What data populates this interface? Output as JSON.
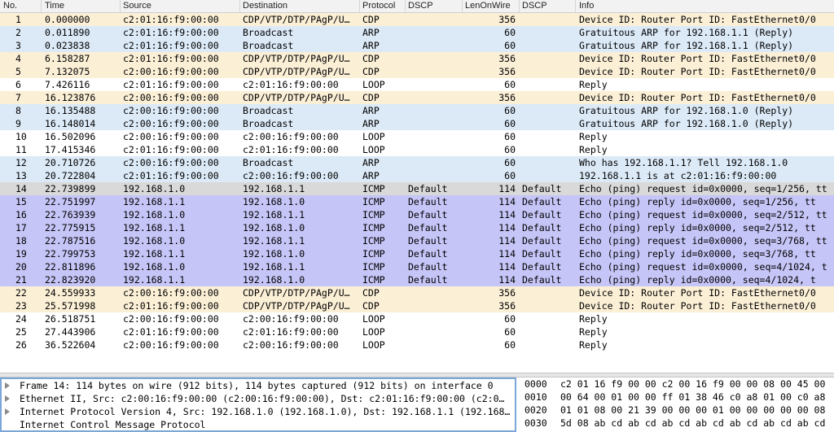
{
  "columns": [
    "No.",
    "Time",
    "Source",
    "Destination",
    "Protocol",
    "DSCP",
    "LenOnWire",
    "DSCP",
    "Info"
  ],
  "colors": {
    "cdp": "#fbefd6",
    "arp": "#dceaf8",
    "loop": "#ffffff",
    "icmp": "#c6c5f7",
    "selected": "#d9d9d9"
  },
  "packets": [
    {
      "no": "1",
      "time": "0.000000",
      "src": "c2:01:16:f9:00:00",
      "dst": "CDP/VTP/DTP/PAgP/U…",
      "proto": "CDP",
      "dscp": "",
      "len": "356",
      "dscp2": "",
      "info": "Device ID: Router  Port ID: FastEthernet0/0",
      "color": "cdp"
    },
    {
      "no": "2",
      "time": "0.011890",
      "src": "c2:01:16:f9:00:00",
      "dst": "Broadcast",
      "proto": "ARP",
      "dscp": "",
      "len": "60",
      "dscp2": "",
      "info": "Gratuitous ARP for 192.168.1.1 (Reply)",
      "color": "arp"
    },
    {
      "no": "3",
      "time": "0.023838",
      "src": "c2:01:16:f9:00:00",
      "dst": "Broadcast",
      "proto": "ARP",
      "dscp": "",
      "len": "60",
      "dscp2": "",
      "info": "Gratuitous ARP for 192.168.1.1 (Reply)",
      "color": "arp"
    },
    {
      "no": "4",
      "time": "6.158287",
      "src": "c2:01:16:f9:00:00",
      "dst": "CDP/VTP/DTP/PAgP/U…",
      "proto": "CDP",
      "dscp": "",
      "len": "356",
      "dscp2": "",
      "info": "Device ID: Router  Port ID: FastEthernet0/0",
      "color": "cdp"
    },
    {
      "no": "5",
      "time": "7.132075",
      "src": "c2:00:16:f9:00:00",
      "dst": "CDP/VTP/DTP/PAgP/U…",
      "proto": "CDP",
      "dscp": "",
      "len": "356",
      "dscp2": "",
      "info": "Device ID: Router  Port ID: FastEthernet0/0",
      "color": "cdp"
    },
    {
      "no": "6",
      "time": "7.426116",
      "src": "c2:01:16:f9:00:00",
      "dst": "c2:01:16:f9:00:00",
      "proto": "LOOP",
      "dscp": "",
      "len": "60",
      "dscp2": "",
      "info": "Reply",
      "color": "loop"
    },
    {
      "no": "7",
      "time": "16.123876",
      "src": "c2:00:16:f9:00:00",
      "dst": "CDP/VTP/DTP/PAgP/U…",
      "proto": "CDP",
      "dscp": "",
      "len": "356",
      "dscp2": "",
      "info": "Device ID: Router  Port ID: FastEthernet0/0",
      "color": "cdp"
    },
    {
      "no": "8",
      "time": "16.135488",
      "src": "c2:00:16:f9:00:00",
      "dst": "Broadcast",
      "proto": "ARP",
      "dscp": "",
      "len": "60",
      "dscp2": "",
      "info": "Gratuitous ARP for 192.168.1.0 (Reply)",
      "color": "arp"
    },
    {
      "no": "9",
      "time": "16.148014",
      "src": "c2:00:16:f9:00:00",
      "dst": "Broadcast",
      "proto": "ARP",
      "dscp": "",
      "len": "60",
      "dscp2": "",
      "info": "Gratuitous ARP for 192.168.1.0 (Reply)",
      "color": "arp"
    },
    {
      "no": "10",
      "time": "16.502096",
      "src": "c2:00:16:f9:00:00",
      "dst": "c2:00:16:f9:00:00",
      "proto": "LOOP",
      "dscp": "",
      "len": "60",
      "dscp2": "",
      "info": "Reply",
      "color": "loop"
    },
    {
      "no": "11",
      "time": "17.415346",
      "src": "c2:01:16:f9:00:00",
      "dst": "c2:01:16:f9:00:00",
      "proto": "LOOP",
      "dscp": "",
      "len": "60",
      "dscp2": "",
      "info": "Reply",
      "color": "loop"
    },
    {
      "no": "12",
      "time": "20.710726",
      "src": "c2:00:16:f9:00:00",
      "dst": "Broadcast",
      "proto": "ARP",
      "dscp": "",
      "len": "60",
      "dscp2": "",
      "info": "Who has 192.168.1.1?  Tell 192.168.1.0",
      "color": "arp"
    },
    {
      "no": "13",
      "time": "20.722804",
      "src": "c2:01:16:f9:00:00",
      "dst": "c2:00:16:f9:00:00",
      "proto": "ARP",
      "dscp": "",
      "len": "60",
      "dscp2": "",
      "info": "192.168.1.1 is at c2:01:16:f9:00:00",
      "color": "arp"
    },
    {
      "no": "14",
      "time": "22.739899",
      "src": "192.168.1.0",
      "dst": "192.168.1.1",
      "proto": "ICMP",
      "dscp": "Default",
      "len": "114",
      "dscp2": "Default",
      "info": "Echo (ping) request  id=0x0000, seq=1/256, tt",
      "color": "selected"
    },
    {
      "no": "15",
      "time": "22.751997",
      "src": "192.168.1.1",
      "dst": "192.168.1.0",
      "proto": "ICMP",
      "dscp": "Default",
      "len": "114",
      "dscp2": "Default",
      "info": "Echo (ping) reply    id=0x0000, seq=1/256, tt",
      "color": "icmp"
    },
    {
      "no": "16",
      "time": "22.763939",
      "src": "192.168.1.0",
      "dst": "192.168.1.1",
      "proto": "ICMP",
      "dscp": "Default",
      "len": "114",
      "dscp2": "Default",
      "info": "Echo (ping) request  id=0x0000, seq=2/512, tt",
      "color": "icmp"
    },
    {
      "no": "17",
      "time": "22.775915",
      "src": "192.168.1.1",
      "dst": "192.168.1.0",
      "proto": "ICMP",
      "dscp": "Default",
      "len": "114",
      "dscp2": "Default",
      "info": "Echo (ping) reply    id=0x0000, seq=2/512, tt",
      "color": "icmp"
    },
    {
      "no": "18",
      "time": "22.787516",
      "src": "192.168.1.0",
      "dst": "192.168.1.1",
      "proto": "ICMP",
      "dscp": "Default",
      "len": "114",
      "dscp2": "Default",
      "info": "Echo (ping) request  id=0x0000, seq=3/768, tt",
      "color": "icmp"
    },
    {
      "no": "19",
      "time": "22.799753",
      "src": "192.168.1.1",
      "dst": "192.168.1.0",
      "proto": "ICMP",
      "dscp": "Default",
      "len": "114",
      "dscp2": "Default",
      "info": "Echo (ping) reply    id=0x0000, seq=3/768, tt",
      "color": "icmp"
    },
    {
      "no": "20",
      "time": "22.811896",
      "src": "192.168.1.0",
      "dst": "192.168.1.1",
      "proto": "ICMP",
      "dscp": "Default",
      "len": "114",
      "dscp2": "Default",
      "info": "Echo (ping) request  id=0x0000, seq=4/1024, t",
      "color": "icmp"
    },
    {
      "no": "21",
      "time": "22.823920",
      "src": "192.168.1.1",
      "dst": "192.168.1.0",
      "proto": "ICMP",
      "dscp": "Default",
      "len": "114",
      "dscp2": "Default",
      "info": "Echo (ping) reply    id=0x0000, seq=4/1024, t",
      "color": "icmp"
    },
    {
      "no": "22",
      "time": "24.559933",
      "src": "c2:00:16:f9:00:00",
      "dst": "CDP/VTP/DTP/PAgP/U…",
      "proto": "CDP",
      "dscp": "",
      "len": "356",
      "dscp2": "",
      "info": "Device ID: Router  Port ID: FastEthernet0/0",
      "color": "cdp"
    },
    {
      "no": "23",
      "time": "25.571998",
      "src": "c2:01:16:f9:00:00",
      "dst": "CDP/VTP/DTP/PAgP/U…",
      "proto": "CDP",
      "dscp": "",
      "len": "356",
      "dscp2": "",
      "info": "Device ID: Router  Port ID: FastEthernet0/0",
      "color": "cdp"
    },
    {
      "no": "24",
      "time": "26.518751",
      "src": "c2:00:16:f9:00:00",
      "dst": "c2:00:16:f9:00:00",
      "proto": "LOOP",
      "dscp": "",
      "len": "60",
      "dscp2": "",
      "info": "Reply",
      "color": "loop"
    },
    {
      "no": "25",
      "time": "27.443906",
      "src": "c2:01:16:f9:00:00",
      "dst": "c2:01:16:f9:00:00",
      "proto": "LOOP",
      "dscp": "",
      "len": "60",
      "dscp2": "",
      "info": "Reply",
      "color": "loop"
    },
    {
      "no": "26",
      "time": "36.522604",
      "src": "c2:00:16:f9:00:00",
      "dst": "c2:00:16:f9:00:00",
      "proto": "LOOP",
      "dscp": "",
      "len": "60",
      "dscp2": "",
      "info": "Reply",
      "color": "loop"
    }
  ],
  "details": [
    "Frame 14: 114 bytes on wire (912 bits), 114 bytes captured (912 bits) on interface 0",
    "Ethernet II, Src: c2:00:16:f9:00:00 (c2:00:16:f9:00:00), Dst: c2:01:16:f9:00:00 (c2:0…",
    "Internet Protocol Version 4, Src: 192.168.1.0 (192.168.1.0), Dst: 192.168.1.1 (192.168…",
    "Internet Control Message Protocol"
  ],
  "hex_rows": [
    {
      "offset": "0000",
      "bytes": "c2 01 16 f9 00 00 c2 00  16 f9 00 00 08 00 45 00"
    },
    {
      "offset": "0010",
      "bytes": "00 64 00 01 00 00 ff 01  38 46 c0 a8 01 00 c0 a8"
    },
    {
      "offset": "0020",
      "bytes": "01 01 08 00 21 39 00 00  00 01 00 00 00 00 00 08"
    },
    {
      "offset": "0030",
      "bytes": "5d 08 ab cd ab cd ab cd  ab cd ab cd ab cd ab cd"
    }
  ]
}
